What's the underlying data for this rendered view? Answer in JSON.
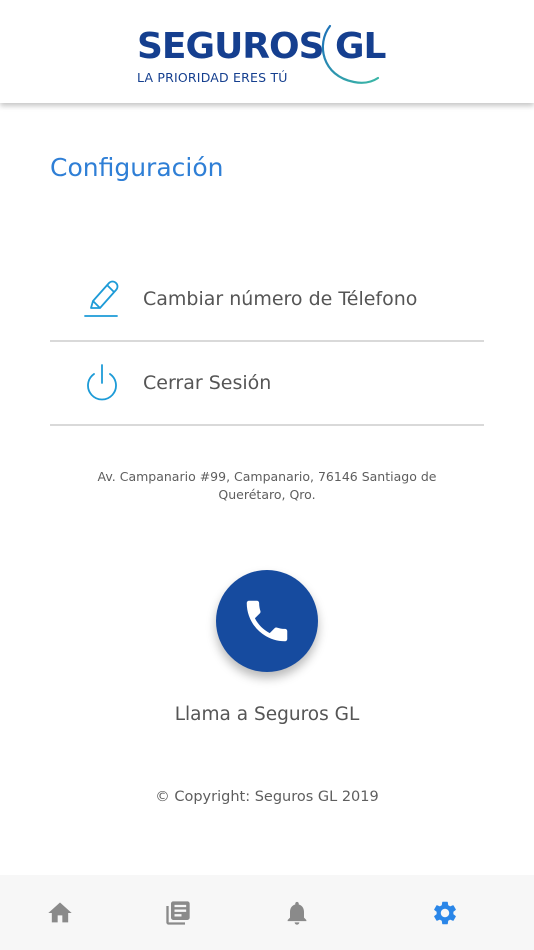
{
  "header": {
    "logo_word": "SEGUROS",
    "logo_gl": "GL",
    "logo_tagline": "LA PRIORIDAD ERES TÚ"
  },
  "page": {
    "title": "Configuración"
  },
  "menu": {
    "items": [
      {
        "label": "Cambiar número de Télefono",
        "icon": "pencil-icon"
      },
      {
        "label": "Cerrar Sesión",
        "icon": "power-icon"
      }
    ]
  },
  "footer": {
    "address": "Av. Campanario #99, Campanario, 76146 Santiago de Querétaro, Qro.",
    "call_label": "Llama a Seguros GL",
    "copyright": "© Copyright: Seguros GL 2019"
  },
  "nav": {
    "items": [
      {
        "icon": "home-icon",
        "active": false
      },
      {
        "icon": "news-icon",
        "active": false
      },
      {
        "icon": "bell-icon",
        "active": false
      },
      {
        "icon": "gear-icon",
        "active": true
      }
    ]
  },
  "colors": {
    "brand": "#153f8f",
    "accent": "#2f7fd6",
    "icon_blue": "#1d9bd7",
    "call_button": "#164b9f",
    "nav_inactive": "#8a8a8a",
    "nav_active": "#2a86e8"
  }
}
